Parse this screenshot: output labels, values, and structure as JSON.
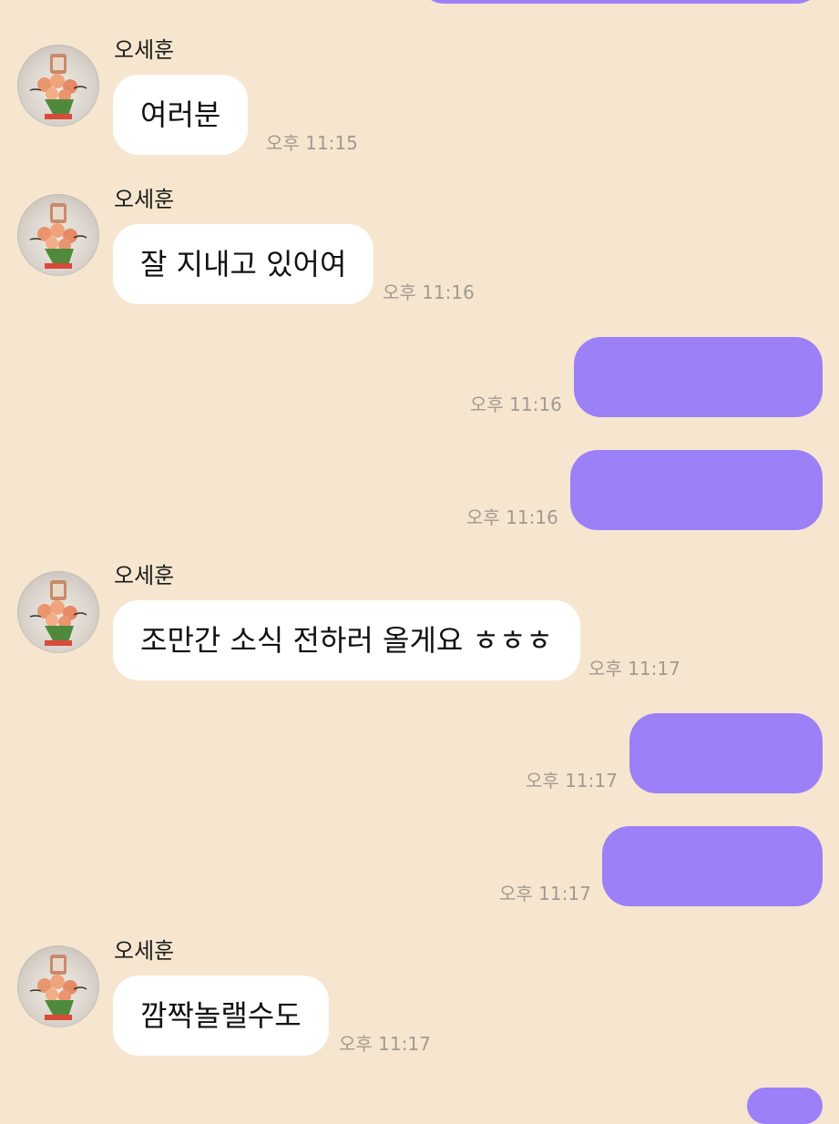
{
  "chat": {
    "messages": [
      {
        "direction": "in",
        "sender": "오세훈",
        "text": "여러분",
        "time": "오후 11:15"
      },
      {
        "direction": "in",
        "sender": "오세훈",
        "text": "잘 지내고 있어여",
        "time": "오후 11:16"
      },
      {
        "direction": "out",
        "text": "",
        "time": "오후 11:16"
      },
      {
        "direction": "out",
        "text": "",
        "time": "오후 11:16"
      },
      {
        "direction": "in",
        "sender": "오세훈",
        "text": "조만간 소식 전하러 올게요 ㅎㅎㅎ",
        "time": "오후 11:17"
      },
      {
        "direction": "out",
        "text": "",
        "time": "오후 11:17"
      },
      {
        "direction": "out",
        "text": "",
        "time": "오후 11:17"
      },
      {
        "direction": "in",
        "sender": "오세훈",
        "text": "깜짝놀랠수도",
        "time": "오후 11:17"
      }
    ]
  },
  "colors": {
    "background": "#f6e6cf",
    "incoming_bubble": "#ffffff",
    "outgoing_bubble": "#9c80f7",
    "timestamp": "#a09a92"
  }
}
